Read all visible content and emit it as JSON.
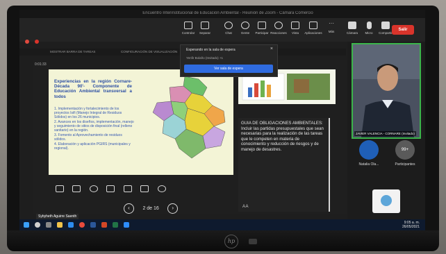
{
  "window": {
    "title": "Encuentro Interinstitucional de Educación Ambiental - Reunión de Zoom - Cámara Comercio"
  },
  "toolbar": {
    "items": [
      "Controlar",
      "Separar",
      "Chat",
      "Gente",
      "Participar",
      "Reacciones",
      "Vista",
      "Aplicaciones",
      "Más",
      "Cámara",
      "Micro",
      "Compartir"
    ],
    "leave": "Salir"
  },
  "share_bar": {
    "left": "MOSTRAR BARRA DE TAREAS",
    "right": "CONFIGURACIÓN DE VISUALIZACIÓN"
  },
  "waiting_room": {
    "title": "Esperando en la sala de espera",
    "person": "Yenfir Bolaño (Invitado) +1",
    "button": "Ver sala de espera"
  },
  "timer": "0:01:33",
  "slide": {
    "title": "Experiencias en la región Cornare- Década 90'- Componente de Educación Ambiental transversal a todos",
    "bullets": [
      "1. Implementación y fortalecimiento de los proyectos Isifi (Manejo Integral de Residuos Sólidos) en los 26 municipios.",
      "2. Avances en los diseños, implementación, manejo y seguimiento de sitios de disposición final (relleno sanitario) en la región.",
      "3. Fomento al Aprovechamiento de residuos sólidos.",
      "4. Elaboración y aplicación PGIRS (municipales y regional)."
    ],
    "map_color_primary": "#e7d23a"
  },
  "notes": {
    "text": "GUIA DE OBLIGACIONES AMBIENTALES: Incluir las partidas presupuestales que sean necesarias para la realización de las tareas que le competen en materia de conocimiento y reducción de riesgos y de manejo de desastres."
  },
  "navigation": {
    "page": "2 de 16"
  },
  "participants": {
    "speaker": "JAVIER VALENCIA - CORNARE (Invitado)",
    "tile1": "Natalia Ola...",
    "tile2": "Participantes",
    "tile2_avatar": "99+"
  },
  "presenter_tag": "Sybyheth Aguirre Saenth",
  "clock": {
    "time": "9:05 a. m.",
    "date": "26/05/2021"
  },
  "colors": {
    "accent": "#2f6be0",
    "leave": "#d9342b",
    "speaker_border": "#3bb54a"
  }
}
